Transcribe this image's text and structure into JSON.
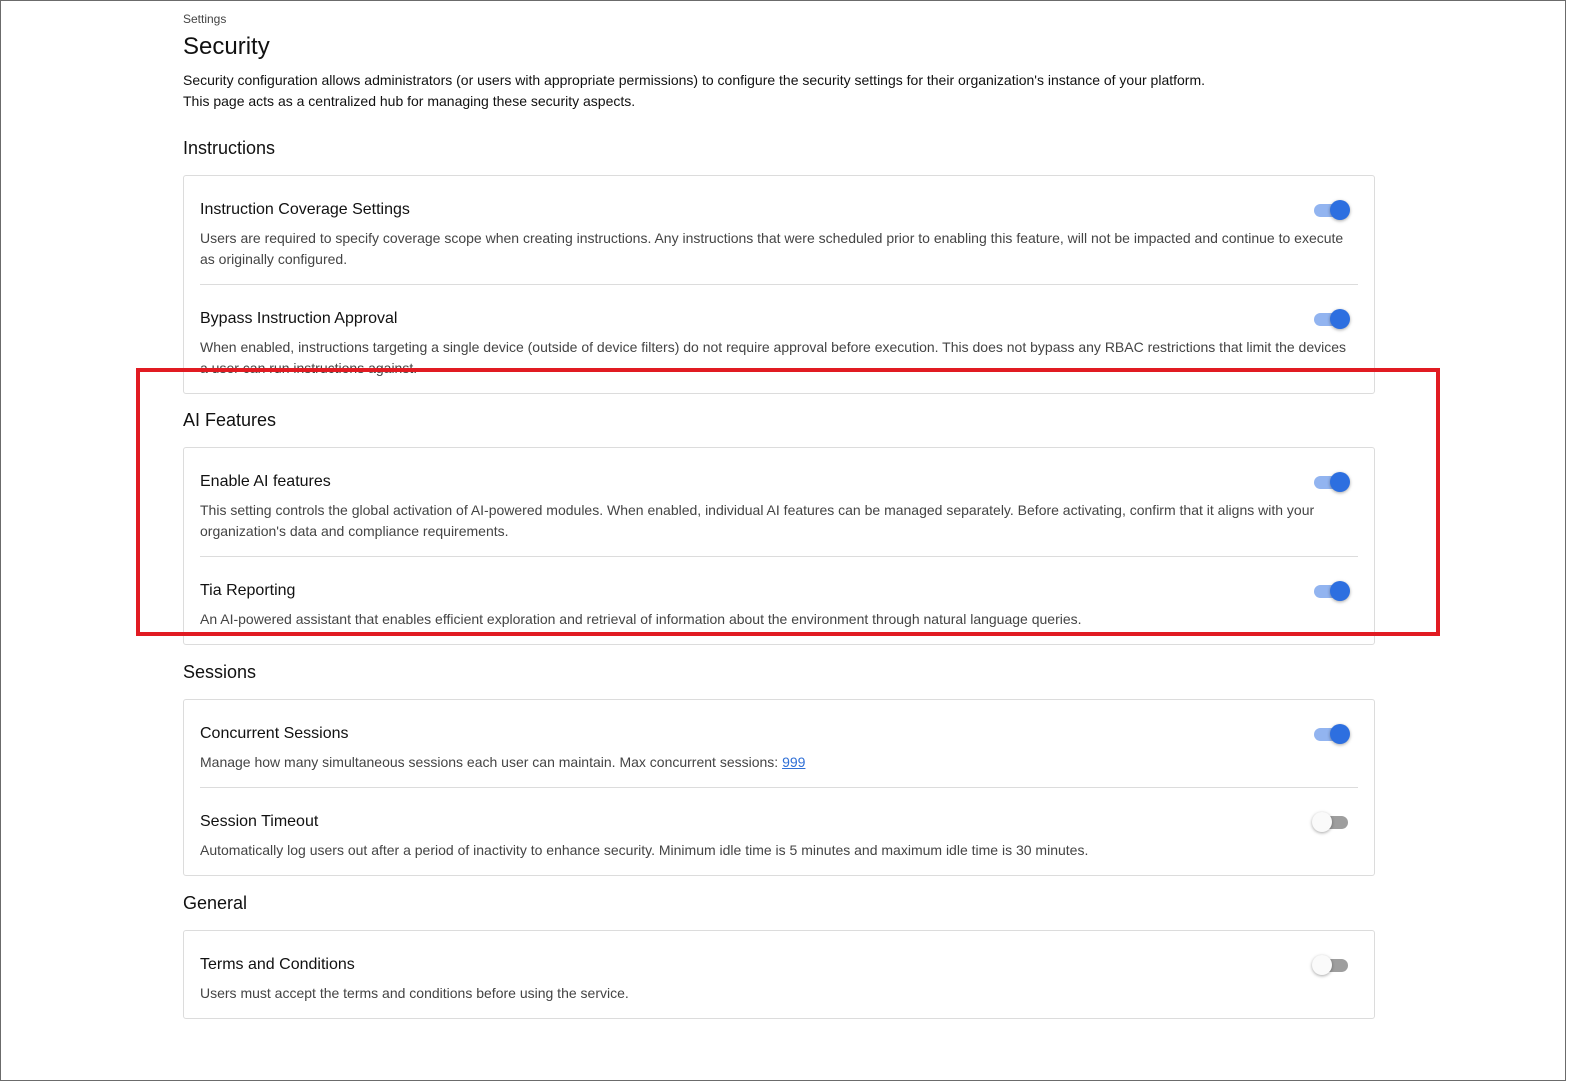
{
  "breadcrumb": "Settings",
  "page": {
    "title": "Security",
    "description": "Security configuration allows administrators (or users with appropriate permissions) to configure the security settings for their organization's instance of your platform. This page acts as a centralized hub for managing these security aspects."
  },
  "sections": {
    "instructions": {
      "title": "Instructions",
      "items": [
        {
          "name": "Instruction Coverage Settings",
          "description": "Users are required to specify coverage scope when creating instructions. Any instructions that were scheduled prior to enabling this feature, will not be impacted and continue to execute as originally configured.",
          "enabled": true
        },
        {
          "name": "Bypass Instruction Approval",
          "description": "When enabled, instructions targeting a single device (outside of device filters) do not require approval before execution. This does not bypass any RBAC restrictions that limit the devices a user can run instructions against.",
          "enabled": true
        }
      ]
    },
    "ai_features": {
      "title": "AI Features",
      "items": [
        {
          "name": "Enable AI features",
          "description": "This setting controls the global activation of AI-powered modules. When enabled, individual AI features can be managed separately. Before activating, confirm that it aligns with your organization's data and compliance requirements.",
          "enabled": true
        },
        {
          "name": "Tia Reporting",
          "description": "An AI-powered assistant that enables efficient exploration and retrieval of information about the environment through natural language queries.",
          "enabled": true
        }
      ]
    },
    "sessions": {
      "title": "Sessions",
      "items": [
        {
          "name": "Concurrent Sessions",
          "description": "Manage how many simultaneous sessions each user can maintain. Max concurrent sessions: ",
          "link_value": "999",
          "enabled": true
        },
        {
          "name": "Session Timeout",
          "description": "Automatically log users out after a period of inactivity to enhance security. Minimum idle time is 5 minutes and maximum idle time is 30 minutes.",
          "enabled": false
        }
      ]
    },
    "general": {
      "title": "General",
      "items": [
        {
          "name": "Terms and Conditions",
          "description": "Users must accept the terms and conditions before using the service.",
          "enabled": false
        }
      ]
    }
  },
  "colors": {
    "toggle_on": "#2d6fe0",
    "toggle_on_track": "#92b4f0",
    "toggle_off_track": "#9e9e9e",
    "highlight": "#e11b22",
    "link": "#2f6fd6"
  }
}
